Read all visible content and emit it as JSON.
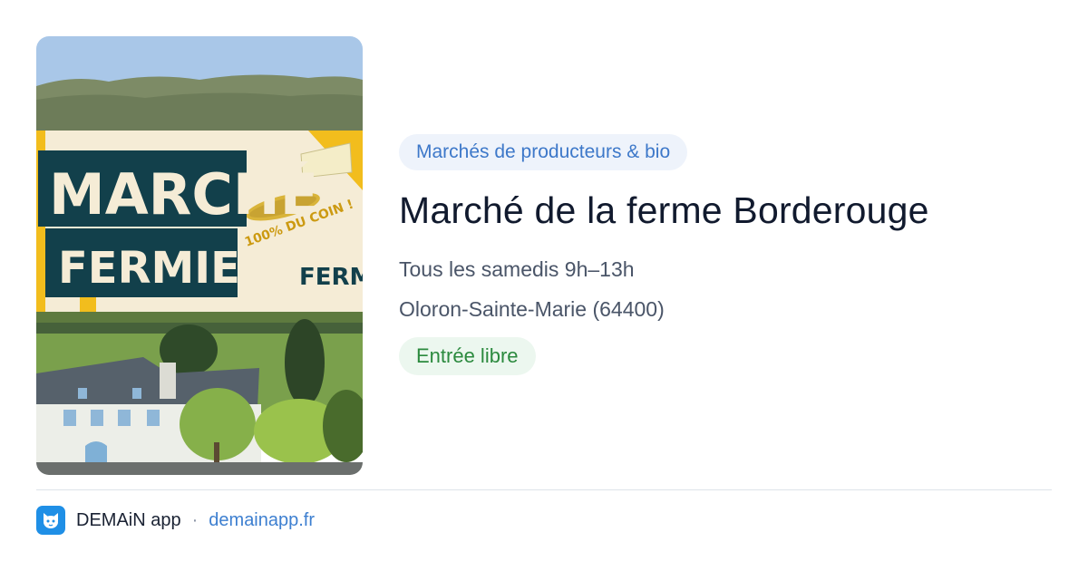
{
  "image": {
    "sign_line1": "MARCHÉ",
    "sign_line2": "FERMIER",
    "sign_tagline": "100% DU COIN !",
    "sign_partial": "FERMI"
  },
  "event": {
    "category": "Marchés de producteurs & bio",
    "title": "Marché de la ferme Borderouge",
    "schedule": "Tous les samedis 9h–13h",
    "location": "Oloron-Sainte-Marie (64400)",
    "entry": "Entrée libre"
  },
  "footer": {
    "app_name": "DEMAiN app",
    "separator": "·",
    "domain": "demainapp.fr",
    "logo_icon": "cat-face-icon"
  },
  "colors": {
    "category_chip_bg": "#eef3fb",
    "category_chip_text": "#3d78c9",
    "entry_chip_bg": "#ecf7ef",
    "entry_chip_text": "#2b8a3e",
    "link": "#3d7fd0",
    "logo": "#1f8fe6"
  }
}
